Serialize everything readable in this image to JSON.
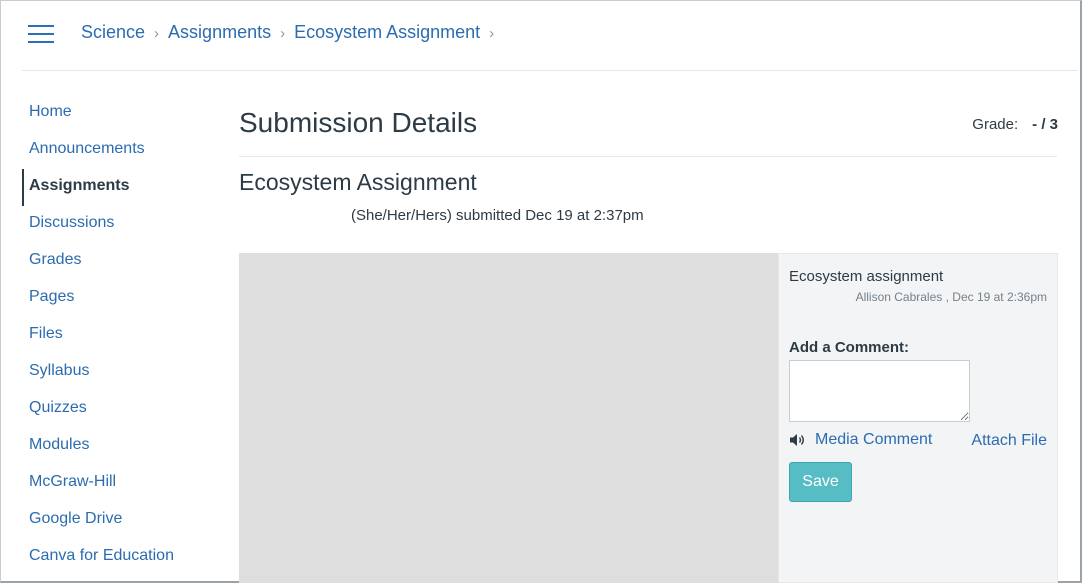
{
  "breadcrumb": {
    "items": [
      "Science",
      "Assignments",
      "Ecosystem Assignment"
    ],
    "separator": ">"
  },
  "sidebar": {
    "items": [
      {
        "label": "Home"
      },
      {
        "label": "Announcements"
      },
      {
        "label": "Assignments",
        "active": true
      },
      {
        "label": "Discussions"
      },
      {
        "label": "Grades"
      },
      {
        "label": "Pages"
      },
      {
        "label": "Files"
      },
      {
        "label": "Syllabus"
      },
      {
        "label": "Quizzes"
      },
      {
        "label": "Modules"
      },
      {
        "label": "McGraw-Hill"
      },
      {
        "label": "Google Drive"
      },
      {
        "label": "Canva for Education"
      }
    ]
  },
  "main": {
    "title": "Submission Details",
    "grade_label": "Grade:",
    "grade_value": "- / 3",
    "assignment_title": "Ecosystem Assignment",
    "submitted_text": "(She/Her/Hers) submitted Dec 19 at 2:37pm"
  },
  "comments": {
    "comment_title": "Ecosystem assignment",
    "comment_meta": "Allison Cabrales , Dec 19 at 2:36pm",
    "add_label": "Add a Comment:",
    "input_value": "",
    "media_label": "Media Comment",
    "attach_label": "Attach File",
    "save_label": "Save"
  },
  "icons": {
    "menu": "hamburger-menu-icon",
    "separator": "chevron-right-icon",
    "media": "speaker-icon"
  },
  "colors": {
    "link": "#2b6cb0",
    "save_button": "#55bdc3",
    "preview_bg": "#dedede",
    "comments_bg": "#f3f4f5"
  }
}
